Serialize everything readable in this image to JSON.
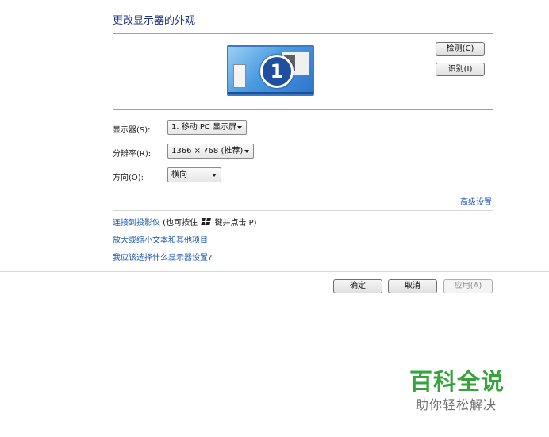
{
  "header": {
    "title": "更改显示器的外观"
  },
  "preview": {
    "monitor_number": "1",
    "detect_button": "检测(C)",
    "identify_button": "识别(I)"
  },
  "settings": {
    "display_label": "显示器(S):",
    "display_value": "1. 移动 PC 显示屏",
    "resolution_label": "分辨率(R):",
    "resolution_value": "1366 × 768 (推荐)",
    "orientation_label": "方向(O):",
    "orientation_value": "横向"
  },
  "links": {
    "advanced": "高级设置",
    "projector": "连接到投影仪",
    "projector_hint_prefix": " (也可按住 ",
    "projector_hint_suffix": " 键并点击 P)",
    "enlarge": "放大或缩小文本和其他项目",
    "which_settings": "我应该选择什么显示器设置?"
  },
  "footer": {
    "ok": "确定",
    "cancel": "取消",
    "apply": "应用(A)"
  },
  "watermark": {
    "title": "百科全说",
    "subtitle": "助你轻松解决"
  },
  "colors": {
    "link": "#1f5ab4",
    "title": "#1e3287",
    "watermark_green": "#37a33f"
  },
  "icons": [
    "windows-key-icon",
    "dropdown-arrow-icon",
    "monitor-icon"
  ]
}
